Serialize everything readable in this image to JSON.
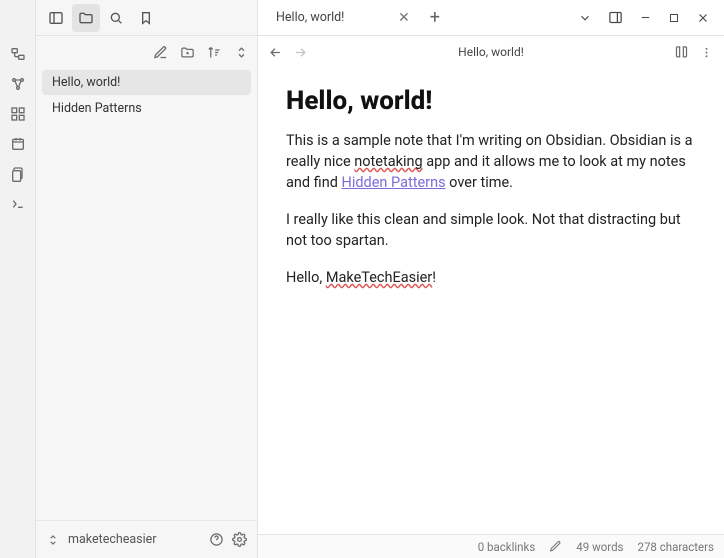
{
  "sidebar": {
    "files": [
      {
        "name": "Hello, world!",
        "active": true
      },
      {
        "name": "Hidden Patterns",
        "active": false
      }
    ]
  },
  "vault": {
    "name": "maketecheasier"
  },
  "tabs": {
    "active": "Hello, world!"
  },
  "view": {
    "title": "Hello, world!"
  },
  "note": {
    "heading": "Hello, world!",
    "p1_a": "This is a sample note that I'm writing on Obsidian. Obsidian is a really nice ",
    "p1_err": "notetaking",
    "p1_b": " app and it allows me to look at my notes and find ",
    "link": "Hidden Patterns",
    "p1_c": " over time.",
    "p2": "I really like this clean and simple look. Not that distracting but not too spartan.",
    "p3_a": "Hello, ",
    "p3_err": "MakeTechEasier",
    "p3_b": "!"
  },
  "status": {
    "backlinks": "0 backlinks",
    "words": "49 words",
    "chars": "278 characters"
  }
}
